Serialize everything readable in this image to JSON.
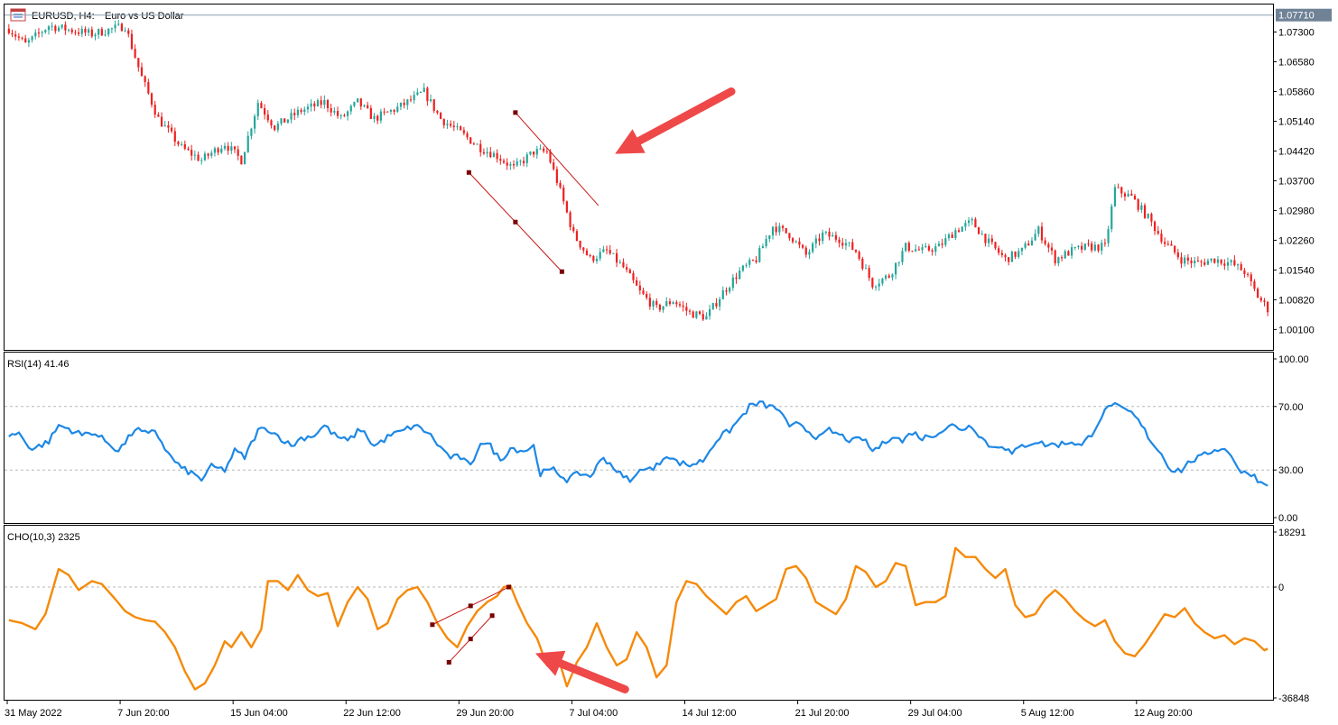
{
  "header": {
    "icon": "chart-window-icon",
    "symbol_label": "EURUSD, H4:",
    "description": "Euro vs US Dollar"
  },
  "colors": {
    "bull": "#26a69a",
    "bear": "#ef2020",
    "rsi_line": "#1e88e5",
    "cho_line": "#f58a0a",
    "annotation": "#c81818",
    "arrow": "#ef4848",
    "bid_badge": "#6f8296"
  },
  "chart_data": [
    {
      "type": "candlestick",
      "title": "EURUSD, H4:  Euro vs US Dollar",
      "ylim": [
        0.9965,
        1.079
      ],
      "y_ticks": [
        "1.07300",
        "1.06580",
        "1.05860",
        "1.05140",
        "1.04420",
        "1.03700",
        "1.02980",
        "1.02260",
        "1.01540",
        "1.00820",
        "1.00100"
      ],
      "current_price_badge": "1.07710",
      "current_price": 1.0771,
      "anchor_path": [
        [
          0,
          1.0738
        ],
        [
          5,
          1.07
        ],
        [
          12,
          1.0745
        ],
        [
          25,
          1.0725
        ],
        [
          35,
          1.0745
        ],
        [
          40,
          1.062
        ],
        [
          45,
          1.052
        ],
        [
          52,
          1.045
        ],
        [
          58,
          1.042
        ],
        [
          65,
          1.046
        ],
        [
          70,
          1.042
        ],
        [
          75,
          1.056
        ],
        [
          80,
          1.05
        ],
        [
          88,
          1.054
        ],
        [
          95,
          1.056
        ],
        [
          100,
          1.052
        ],
        [
          105,
          1.056
        ],
        [
          110,
          1.052
        ],
        [
          118,
          1.055
        ],
        [
          125,
          1.0585
        ],
        [
          130,
          1.052
        ],
        [
          137,
          1.048
        ],
        [
          142,
          1.045
        ],
        [
          147,
          1.043
        ],
        [
          152,
          1.04
        ],
        [
          158,
          1.044
        ],
        [
          162,
          1.044
        ],
        [
          165,
          1.037
        ],
        [
          170,
          1.024
        ],
        [
          175,
          1.018
        ],
        [
          180,
          1.02
        ],
        [
          185,
          1.016
        ],
        [
          190,
          1.01
        ],
        [
          195,
          1.006
        ],
        [
          200,
          1.008
        ],
        [
          205,
          1.005
        ],
        [
          210,
          1.004
        ],
        [
          215,
          1.01
        ],
        [
          220,
          1.015
        ],
        [
          225,
          1.018
        ],
        [
          230,
          1.026
        ],
        [
          235,
          1.024
        ],
        [
          240,
          1.019
        ],
        [
          245,
          1.024
        ],
        [
          250,
          1.023
        ],
        [
          255,
          1.02
        ],
        [
          260,
          1.012
        ],
        [
          265,
          1.014
        ],
        [
          270,
          1.021
        ],
        [
          275,
          1.02
        ],
        [
          280,
          1.021
        ],
        [
          285,
          1.025
        ],
        [
          290,
          1.027
        ],
        [
          295,
          1.022
        ],
        [
          300,
          1.018
        ],
        [
          305,
          1.02
        ],
        [
          310,
          1.025
        ],
        [
          315,
          1.018
        ],
        [
          320,
          1.02
        ],
        [
          325,
          1.021
        ],
        [
          330,
          1.021
        ],
        [
          333,
          1.035
        ],
        [
          338,
          1.033
        ],
        [
          343,
          1.028
        ],
        [
          348,
          1.022
        ],
        [
          353,
          1.018
        ],
        [
          358,
          1.017
        ],
        [
          363,
          1.018
        ],
        [
          368,
          1.017
        ],
        [
          372,
          1.015
        ],
        [
          376,
          1.009
        ],
        [
          380,
          1.005
        ]
      ],
      "channel_lines": [
        {
          "start": [
            153,
            1.0535
          ],
          "end": [
            178,
            1.031
          ],
          "handles": false
        },
        {
          "start": [
            139,
            1.039
          ],
          "end": [
            167,
            1.015
          ],
          "handles": true
        }
      ]
    },
    {
      "type": "line",
      "title": "RSI(14) 41.46",
      "ylim": [
        0,
        100
      ],
      "y_ticks": [
        "100.00",
        "70.00",
        "30.00",
        "0.00"
      ],
      "levels": [
        70,
        30
      ],
      "anchor_path": [
        [
          0,
          52
        ],
        [
          3,
          53
        ],
        [
          7,
          43
        ],
        [
          12,
          48
        ],
        [
          15,
          58
        ],
        [
          18,
          56
        ],
        [
          22,
          52
        ],
        [
          25,
          54
        ],
        [
          30,
          47
        ],
        [
          33,
          42
        ],
        [
          36,
          50
        ],
        [
          38,
          56
        ],
        [
          42,
          52
        ],
        [
          44,
          55
        ],
        [
          48,
          40
        ],
        [
          52,
          31
        ],
        [
          55,
          28
        ],
        [
          58,
          24
        ],
        [
          61,
          32
        ],
        [
          65,
          30
        ],
        [
          68,
          42
        ],
        [
          71,
          38
        ],
        [
          75,
          55
        ],
        [
          78,
          56
        ],
        [
          82,
          50
        ],
        [
          85,
          45
        ],
        [
          88,
          50
        ],
        [
          92,
          52
        ],
        [
          95,
          58
        ],
        [
          98,
          52
        ],
        [
          102,
          48
        ],
        [
          106,
          56
        ],
        [
          110,
          45
        ],
        [
          115,
          52
        ],
        [
          118,
          54
        ],
        [
          122,
          58
        ],
        [
          126,
          54
        ],
        [
          130,
          44
        ],
        [
          133,
          38
        ],
        [
          136,
          38
        ],
        [
          139,
          32
        ],
        [
          142,
          48
        ],
        [
          145,
          45
        ],
        [
          148,
          36
        ],
        [
          151,
          44
        ],
        [
          155,
          42
        ],
        [
          158,
          45
        ],
        [
          160,
          28
        ],
        [
          164,
          30
        ],
        [
          168,
          24
        ],
        [
          172,
          28
        ],
        [
          175,
          26
        ],
        [
          179,
          38
        ],
        [
          182,
          32
        ],
        [
          185,
          25
        ],
        [
          188,
          24
        ],
        [
          191,
          32
        ],
        [
          194,
          30
        ],
        [
          198,
          40
        ],
        [
          201,
          35
        ],
        [
          205,
          33
        ],
        [
          209,
          36
        ],
        [
          213,
          49
        ],
        [
          217,
          55
        ],
        [
          220,
          62
        ],
        [
          223,
          70
        ],
        [
          226,
          72
        ],
        [
          229,
          70
        ],
        [
          232,
          68
        ],
        [
          235,
          56
        ],
        [
          238,
          60
        ],
        [
          241,
          54
        ],
        [
          244,
          50
        ],
        [
          247,
          55
        ],
        [
          250,
          52
        ],
        [
          254,
          48
        ],
        [
          257,
          50
        ],
        [
          260,
          42
        ],
        [
          263,
          46
        ],
        [
          266,
          52
        ],
        [
          269,
          48
        ],
        [
          272,
          54
        ],
        [
          275,
          50
        ],
        [
          278,
          52
        ],
        [
          281,
          55
        ],
        [
          284,
          58
        ],
        [
          287,
          56
        ],
        [
          290,
          58
        ],
        [
          293,
          50
        ],
        [
          296,
          44
        ],
        [
          299,
          46
        ],
        [
          302,
          40
        ],
        [
          305,
          45
        ],
        [
          309,
          48
        ],
        [
          312,
          46
        ],
        [
          316,
          46
        ],
        [
          320,
          48
        ],
        [
          323,
          45
        ],
        [
          326,
          53
        ],
        [
          329,
          64
        ],
        [
          332,
          72
        ],
        [
          335,
          68
        ],
        [
          338,
          66
        ],
        [
          341,
          58
        ],
        [
          344,
          48
        ],
        [
          347,
          40
        ],
        [
          350,
          30
        ],
        [
          353,
          30
        ],
        [
          356,
          36
        ],
        [
          359,
          38
        ],
        [
          362,
          42
        ],
        [
          365,
          44
        ],
        [
          368,
          40
        ],
        [
          371,
          28
        ],
        [
          374,
          28
        ],
        [
          377,
          22
        ],
        [
          380,
          22
        ]
      ]
    },
    {
      "type": "line",
      "title": "CHO(10,3) 2325",
      "ylim": [
        -36848,
        18291
      ],
      "y_ticks": [
        "18291",
        "0",
        "-36848"
      ],
      "levels": [
        0
      ],
      "anchor_path": [
        [
          0,
          -11000
        ],
        [
          4,
          -12000
        ],
        [
          8,
          -14000
        ],
        [
          11,
          -9000
        ],
        [
          15,
          6000
        ],
        [
          18,
          4000
        ],
        [
          21,
          -1000
        ],
        [
          25,
          2000
        ],
        [
          28,
          1000
        ],
        [
          32,
          -4000
        ],
        [
          35,
          -8000
        ],
        [
          38,
          -10000
        ],
        [
          41,
          -11000
        ],
        [
          44,
          -11500
        ],
        [
          47,
          -15000
        ],
        [
          50,
          -20000
        ],
        [
          53,
          -28000
        ],
        [
          56,
          -34000
        ],
        [
          59,
          -32000
        ],
        [
          62,
          -26000
        ],
        [
          65,
          -18000
        ],
        [
          67,
          -20000
        ],
        [
          70,
          -15000
        ],
        [
          73,
          -20000
        ],
        [
          76,
          -14000
        ],
        [
          78,
          2000
        ],
        [
          81,
          2000
        ],
        [
          84,
          -1000
        ],
        [
          87,
          4000
        ],
        [
          90,
          -1000
        ],
        [
          93,
          -3000
        ],
        [
          96,
          -2000
        ],
        [
          99,
          -13000
        ],
        [
          102,
          -5000
        ],
        [
          105,
          0
        ],
        [
          108,
          -4000
        ],
        [
          111,
          -14000
        ],
        [
          114,
          -12000
        ],
        [
          117,
          -4000
        ],
        [
          120,
          -1000
        ],
        [
          123,
          0
        ],
        [
          126,
          -5000
        ],
        [
          129,
          -12000
        ],
        [
          132,
          -17000
        ],
        [
          135,
          -20000
        ],
        [
          138,
          -13000
        ],
        [
          141,
          -8000
        ],
        [
          144,
          -5000
        ],
        [
          147,
          -3000
        ],
        [
          149,
          0
        ],
        [
          151,
          500
        ],
        [
          153,
          -5000
        ],
        [
          156,
          -12000
        ],
        [
          159,
          -17000
        ],
        [
          162,
          -26000
        ],
        [
          165,
          -22000
        ],
        [
          168,
          -33000
        ],
        [
          171,
          -25000
        ],
        [
          174,
          -20000
        ],
        [
          177,
          -12000
        ],
        [
          180,
          -20000
        ],
        [
          183,
          -26000
        ],
        [
          186,
          -24000
        ],
        [
          189,
          -15000
        ],
        [
          192,
          -20000
        ],
        [
          195,
          -30000
        ],
        [
          198,
          -26000
        ],
        [
          201,
          -5000
        ],
        [
          204,
          2000
        ],
        [
          207,
          1000
        ],
        [
          210,
          -3000
        ],
        [
          213,
          -6000
        ],
        [
          216,
          -9000
        ],
        [
          219,
          -5000
        ],
        [
          222,
          -3000
        ],
        [
          225,
          -8000
        ],
        [
          228,
          -6000
        ],
        [
          231,
          -4000
        ],
        [
          234,
          6000
        ],
        [
          237,
          7000
        ],
        [
          240,
          3000
        ],
        [
          243,
          -5000
        ],
        [
          246,
          -7000
        ],
        [
          249,
          -9000
        ],
        [
          252,
          -4000
        ],
        [
          255,
          7000
        ],
        [
          258,
          5000
        ],
        [
          261,
          0
        ],
        [
          264,
          2000
        ],
        [
          267,
          8000
        ],
        [
          270,
          7000
        ],
        [
          273,
          -6000
        ],
        [
          276,
          -5000
        ],
        [
          279,
          -5000
        ],
        [
          282,
          -3000
        ],
        [
          285,
          13000
        ],
        [
          288,
          10000
        ],
        [
          291,
          10000
        ],
        [
          294,
          6000
        ],
        [
          297,
          3000
        ],
        [
          300,
          6000
        ],
        [
          303,
          -6000
        ],
        [
          306,
          -10000
        ],
        [
          309,
          -9000
        ],
        [
          312,
          -4000
        ],
        [
          315,
          -1000
        ],
        [
          318,
          -4000
        ],
        [
          321,
          -8000
        ],
        [
          324,
          -11000
        ],
        [
          327,
          -13000
        ],
        [
          330,
          -11000
        ],
        [
          333,
          -18000
        ],
        [
          336,
          -22000
        ],
        [
          339,
          -23000
        ],
        [
          342,
          -19000
        ],
        [
          345,
          -14000
        ],
        [
          348,
          -9000
        ],
        [
          351,
          -10000
        ],
        [
          354,
          -7000
        ],
        [
          357,
          -12000
        ],
        [
          360,
          -15000
        ],
        [
          363,
          -17000
        ],
        [
          366,
          -16000
        ],
        [
          369,
          -19000
        ],
        [
          372,
          -17000
        ],
        [
          375,
          -18000
        ],
        [
          378,
          -21000
        ],
        [
          380,
          -20000
        ]
      ],
      "channel_lines": [
        {
          "start": [
            128,
            -12500
          ],
          "end": [
            151,
            0
          ],
          "handles": true
        },
        {
          "start": [
            133,
            -25000
          ],
          "end": [
            146,
            -9500
          ],
          "handles": true
        }
      ]
    }
  ],
  "x_axis": {
    "bar_count": 380,
    "labels": [
      {
        "bar": 0,
        "text": "31 May 2022"
      },
      {
        "bar": 34,
        "text": "7 Jun 20:00"
      },
      {
        "bar": 68,
        "text": "15 Jun 04:00"
      },
      {
        "bar": 102,
        "text": "22 Jun 12:00"
      },
      {
        "bar": 136,
        "text": "29 Jun 20:00"
      },
      {
        "bar": 170,
        "text": "7 Jul 04:00"
      },
      {
        "bar": 204,
        "text": "14 Jul 12:00"
      },
      {
        "bar": 238,
        "text": "21 Jul 20:00"
      },
      {
        "bar": 272,
        "text": "29 Jul 04:00"
      },
      {
        "bar": 306,
        "text": "5 Aug 12:00"
      },
      {
        "bar": 340,
        "text": "12 Aug 20:00"
      }
    ]
  },
  "arrows": [
    {
      "name": "price-arrow",
      "pane": 0,
      "from": [
        218,
        1.0586
      ],
      "to": [
        183,
        1.0435
      ]
    },
    {
      "name": "cho-arrow",
      "pane": 2,
      "from": [
        186,
        -34000
      ],
      "to": [
        159,
        -22000
      ]
    }
  ]
}
